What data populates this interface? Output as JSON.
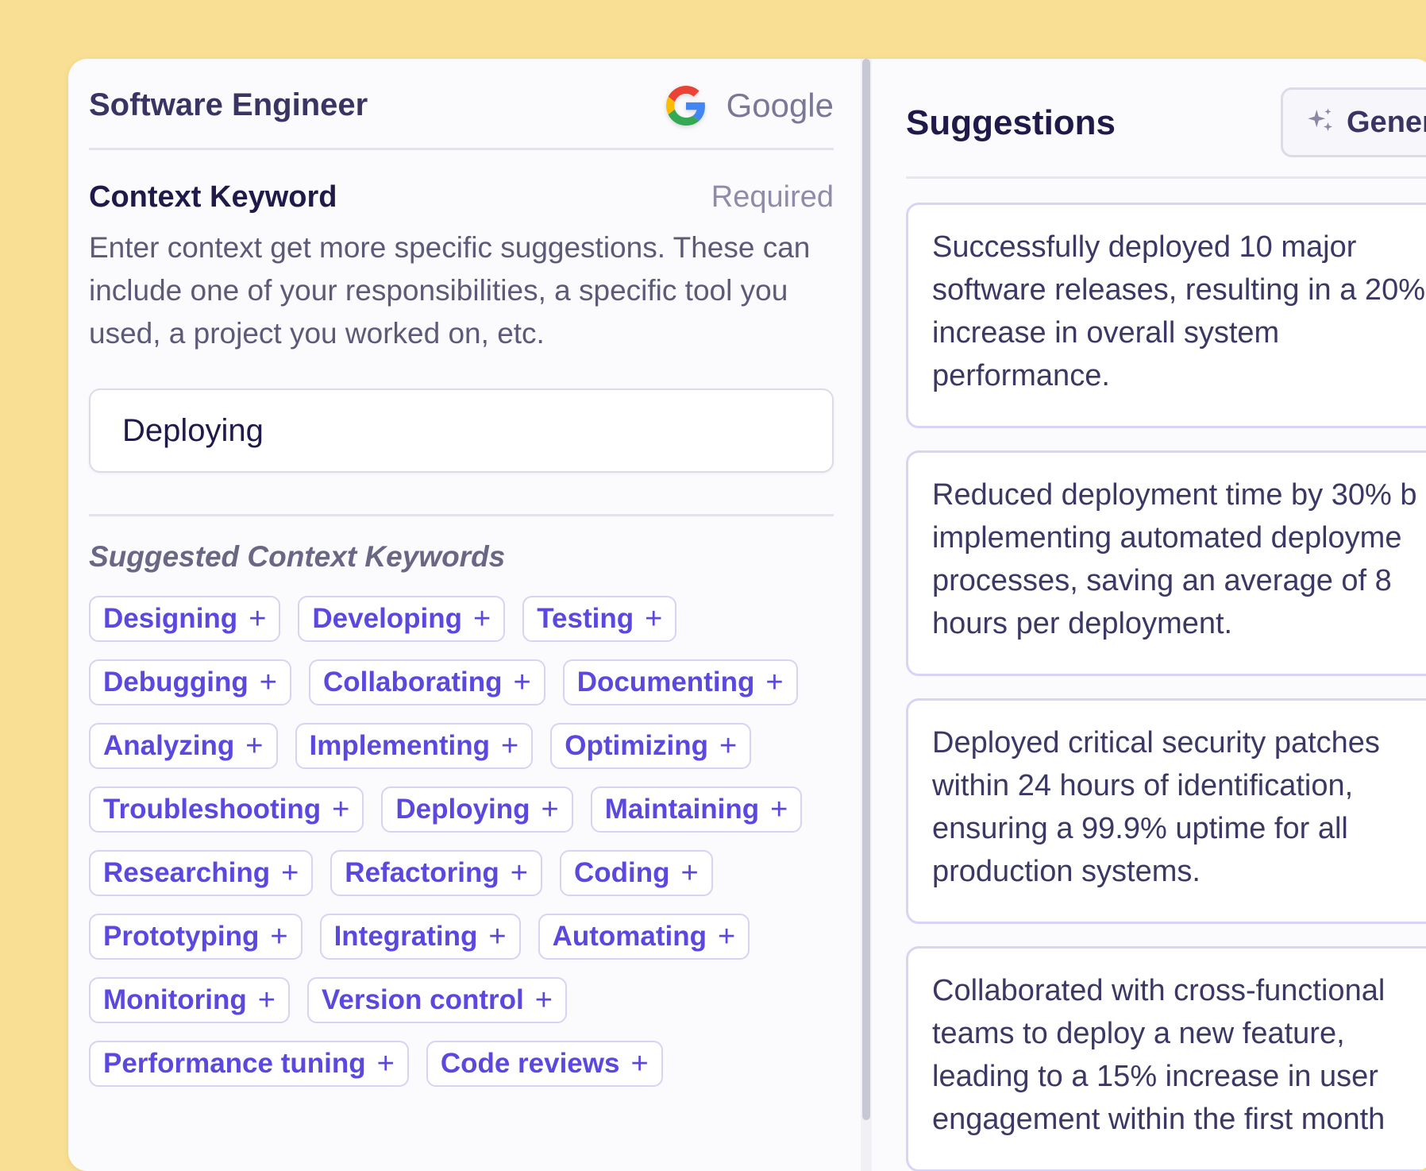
{
  "job": {
    "title": "Software Engineer",
    "company": "Google"
  },
  "context": {
    "title": "Context Keyword",
    "required": "Required",
    "description": "Enter context get more specific suggestions. These can include one of your responsibilities, a specific tool you used, a project you worked on, etc.",
    "input_value": "Deploying"
  },
  "suggested_keywords": {
    "title": "Suggested Context Keywords",
    "items": [
      "Designing",
      "Developing",
      "Testing",
      "Debugging",
      "Collaborating",
      "Documenting",
      "Analyzing",
      "Implementing",
      "Optimizing",
      "Troubleshooting",
      "Deploying",
      "Maintaining",
      "Researching",
      "Refactoring",
      "Coding",
      "Prototyping",
      "Integrating",
      "Automating",
      "Monitoring",
      "Version control",
      "Performance tuning",
      "Code reviews"
    ],
    "add_symbol": "+"
  },
  "suggestions": {
    "title": "Suggestions",
    "generate_label": "Gener",
    "cards": [
      [
        "Successfully deployed 10 major",
        "software releases, resulting in a 20%",
        "increase in overall system",
        "performance."
      ],
      [
        "Reduced deployment time by 30% b",
        "implementing automated deployme",
        "processes, saving an average of 8",
        "hours per deployment."
      ],
      [
        "Deployed critical security patches",
        "within 24 hours of identification,",
        "ensuring a 99.9% uptime for all",
        "production systems."
      ],
      [
        "Collaborated with cross-functional",
        "teams to deploy a new feature,",
        "leading to a 15% increase in user",
        "engagement within the first month"
      ]
    ]
  }
}
